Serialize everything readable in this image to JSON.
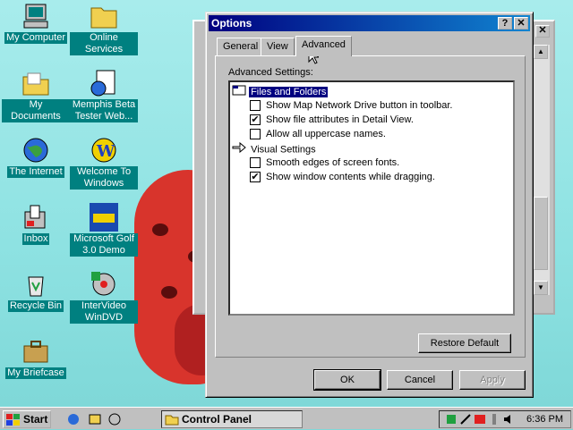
{
  "desktop": {
    "icons": [
      {
        "label": "My Computer"
      },
      {
        "label": "Online Services"
      },
      {
        "label": "My Documents"
      },
      {
        "label": "Memphis Beta Tester Web..."
      },
      {
        "label": "The Internet"
      },
      {
        "label": "Welcome To Windows"
      },
      {
        "label": "Inbox"
      },
      {
        "label": "Microsoft Golf 3.0 Demo"
      },
      {
        "label": "Recycle Bin"
      },
      {
        "label": "InterVideo WinDVD"
      },
      {
        "label": "My Briefcase"
      }
    ]
  },
  "dialog": {
    "title": "Options",
    "help_btn": "?",
    "close_btn": "✕",
    "tabs": [
      {
        "label": "General",
        "active": false
      },
      {
        "label": "View",
        "active": false
      },
      {
        "label": "Advanced",
        "active": true
      }
    ],
    "advanced_label": "Advanced Settings:",
    "groups": [
      {
        "label": "Files and Folders",
        "items": [
          {
            "label": "Show Map Network Drive button in toolbar.",
            "checked": false
          },
          {
            "label": "Show file attributes in Detail View.",
            "checked": true
          },
          {
            "label": "Allow all uppercase names.",
            "checked": false
          }
        ]
      },
      {
        "label": "Visual Settings",
        "items": [
          {
            "label": "Smooth edges of screen fonts.",
            "checked": false
          },
          {
            "label": "Show window contents while dragging.",
            "checked": true
          }
        ]
      }
    ],
    "restore_default": "Restore Default",
    "ok": "OK",
    "cancel": "Cancel",
    "apply": "Apply"
  },
  "behind_window": {
    "close_btn": "✕"
  },
  "taskbar": {
    "start_label": "Start",
    "task_label": "Control Panel",
    "clock": "6:36 PM"
  }
}
